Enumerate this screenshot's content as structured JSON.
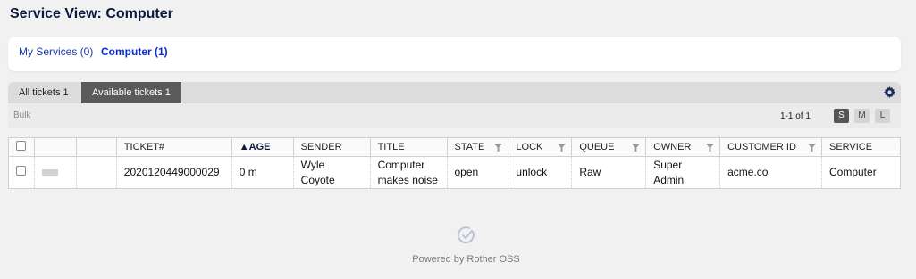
{
  "page": {
    "title": "Service View: Computer"
  },
  "services": [
    {
      "label": "My Services (0)",
      "active": false
    },
    {
      "label": "Computer (1)",
      "active": true
    }
  ],
  "tabs": [
    {
      "label": "All tickets 1",
      "active": false
    },
    {
      "label": "Available tickets 1",
      "active": true
    }
  ],
  "toolbar": {
    "bulk_label": "Bulk",
    "pager": "1-1 of 1",
    "sizes": [
      "S",
      "M",
      "L"
    ],
    "selected_size": "S"
  },
  "table": {
    "columns": {
      "ticket": "TICKET#",
      "age": "▲AGE",
      "sender": "SENDER",
      "title": "TITLE",
      "state": "STATE",
      "lock": "LOCK",
      "queue": "QUEUE",
      "owner": "OWNER",
      "customer_id": "CUSTOMER ID",
      "service": "SERVICE"
    },
    "rows": [
      {
        "ticket": "2020120449000029",
        "age": "0 m",
        "sender_line1": "Wyle",
        "sender_line2": "Coyote",
        "title_line1": "Computer",
        "title_line2": "makes noise",
        "state": "open",
        "lock": "unlock",
        "queue": "Raw",
        "owner_line1": "Super",
        "owner_line2": "Admin",
        "customer_id": "acme.co",
        "service": "Computer"
      }
    ]
  },
  "footer": {
    "text": "Powered by Rother OSS"
  },
  "colors": {
    "link": "#1c39b4",
    "active_tab": "#5a5a5a",
    "title": "#0a1a3c"
  }
}
